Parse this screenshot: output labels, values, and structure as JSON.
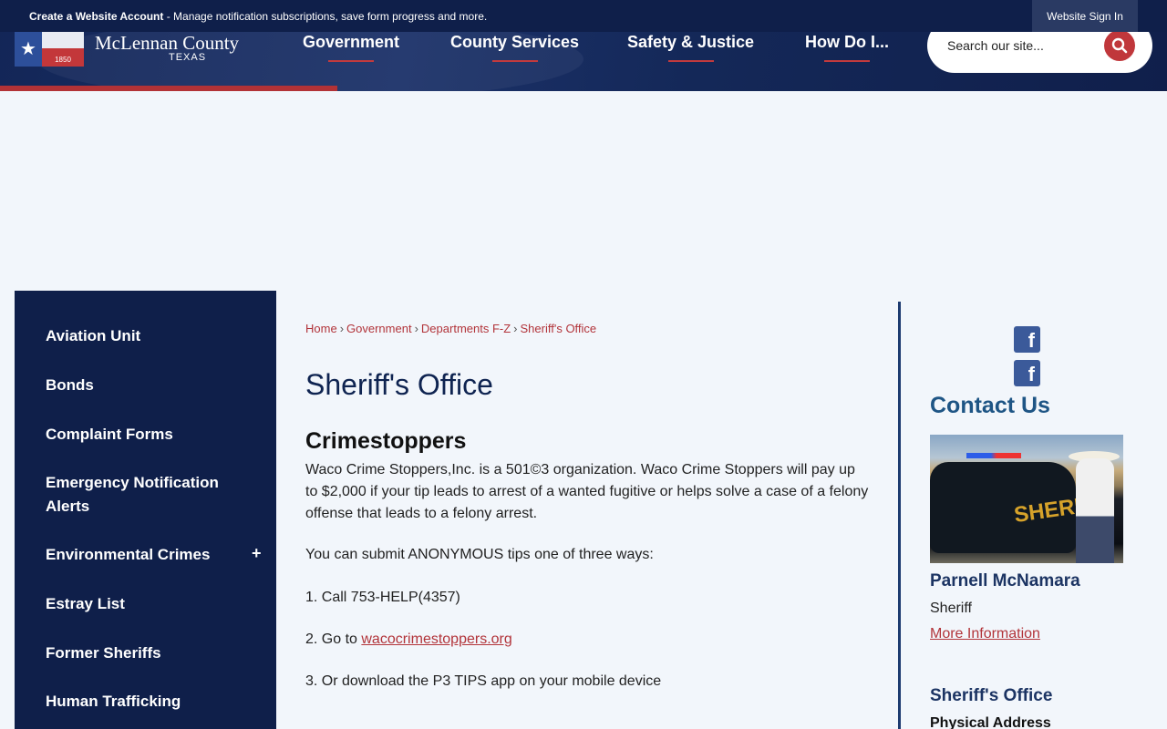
{
  "topbar": {
    "create_account": "Create a Website Account",
    "notice_text": " - Manage notification subscriptions, save form progress and more.",
    "sign_in": "Website Sign In"
  },
  "logo": {
    "name": "McLennan County",
    "state": "TEXAS",
    "flag_year": "1850"
  },
  "nav": {
    "items": [
      {
        "label": "Government"
      },
      {
        "label": "County Services"
      },
      {
        "label": "Safety & Justice"
      },
      {
        "label": "How Do I..."
      }
    ]
  },
  "search": {
    "placeholder": "Search our site...",
    "icon": "search-icon"
  },
  "sidebar": {
    "items": [
      {
        "label": "Aviation Unit"
      },
      {
        "label": "Bonds"
      },
      {
        "label": "Complaint Forms"
      },
      {
        "label": "Emergency Notification Alerts"
      },
      {
        "label": "Environmental Crimes",
        "expand": "+"
      },
      {
        "label": "Estray List"
      },
      {
        "label": "Former Sheriffs"
      },
      {
        "label": "Human Trafficking"
      }
    ]
  },
  "breadcrumb": {
    "items": [
      "Home",
      "Government",
      "Departments F-Z",
      "Sheriff's Office"
    ],
    "separator": "›"
  },
  "content": {
    "title": "Sheriff's Office",
    "heading": "Crimestoppers",
    "paragraph": "Waco Crime Stoppers,Inc. is a 501©3 organization. Waco Crime Stoppers will pay up to $2,000 if your tip leads to arrest of a wanted fugitive or helps solve a case of a felony offense that leads to a felony arrest.",
    "ways_intro": " You can submit ANONYMOUS tips one of three ways:",
    "way1": "1.  Call 753-HELP(4357)",
    "way2_prefix": "2.  Go to ",
    "way2_link": "wacocrimestoppers.org",
    "way3": "3. Or download the P3 TIPS app on your mobile device"
  },
  "contact": {
    "heading": "Contact Us",
    "photo_text": "SHERIFF",
    "name": "Parnell McNamara",
    "role": "Sheriff",
    "more_link": "More Information",
    "office_heading": "Sheriff's Office",
    "address_heading": "Physical Address"
  },
  "colors": {
    "navy": "#0f1f4a",
    "accent_red": "#b2343a",
    "title_blue": "#0f2451",
    "contact_blue": "#1e5585"
  }
}
